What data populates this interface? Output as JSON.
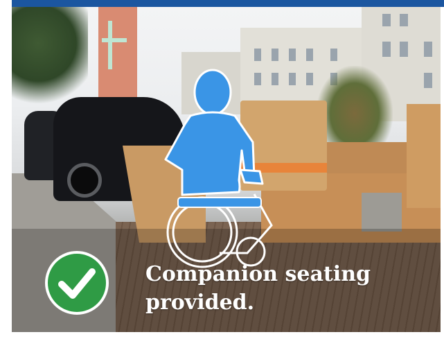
{
  "caption": {
    "text": "Companion seating provided."
  },
  "icons": {
    "badge": "checkmark-icon",
    "figure": "wheelchair-user-icon"
  },
  "colors": {
    "top_bar": "#1b56a0",
    "figure_fill": "#3a95e6",
    "badge_fill": "#2f9b45",
    "caption_text": "#ffffff"
  }
}
